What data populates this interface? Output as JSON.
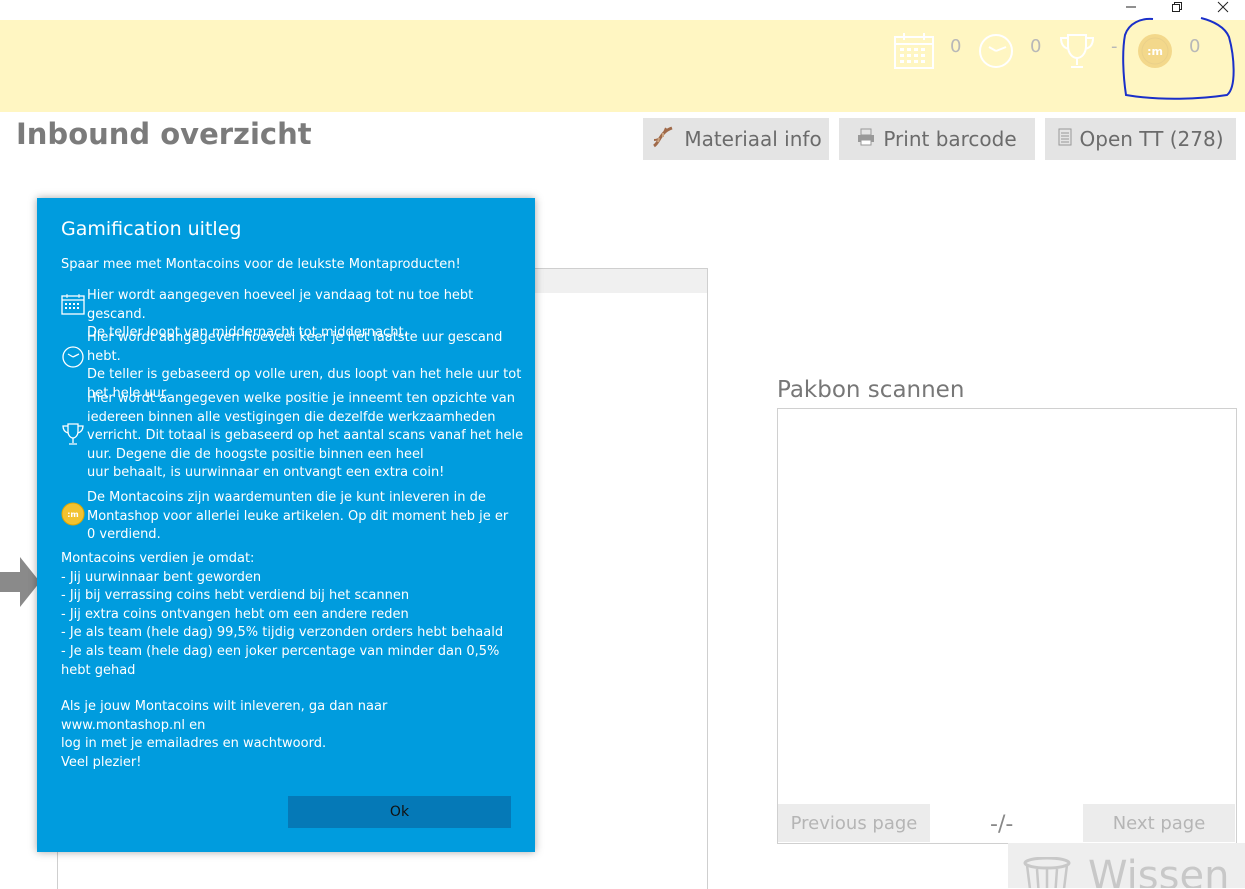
{
  "stats": {
    "today_count": "0",
    "hour_count": "0",
    "position": "-",
    "coins": "0"
  },
  "page": {
    "title": "Inbound overzicht"
  },
  "toolbar": {
    "materiaal_info": "Materiaal info",
    "print_barcode": "Print barcode",
    "open_tt": "Open TT (278)"
  },
  "pakbon": {
    "title": "Pakbon scannen",
    "previous": "Previous page",
    "next": "Next page",
    "indicator": "-/-"
  },
  "wissen": {
    "label": "Wissen"
  },
  "dialog": {
    "title": "Gamification uitleg",
    "intro": "Spaar mee met Montacoins voor de leukste Montaproducten!",
    "items": [
      {
        "icon": "calendar-icon",
        "lines": [
          "Hier wordt aangegeven hoeveel je vandaag tot nu toe hebt gescand.",
          "De teller loopt van middernacht tot middernacht."
        ]
      },
      {
        "icon": "clock-icon",
        "lines": [
          "Hier wordt aangegeven hoeveel keer je het laatste uur gescand hebt.",
          "De teller is gebaseerd op volle uren, dus loopt van het hele uur tot",
          "het hele uur."
        ]
      },
      {
        "icon": "trophy-icon",
        "lines": [
          "Hier wordt aangegeven welke positie je inneemt ten opzichte van",
          "iedereen binnen alle vestigingen die dezelfde werkzaamheden",
          "verricht. Dit totaal is gebaseerd op het aantal scans vanaf het hele",
          "uur. Degene die de hoogste positie binnen een heel",
          "uur behaalt, is uurwinnaar en ontvangt een extra coin!"
        ]
      },
      {
        "icon": "montacoin-icon",
        "lines": [
          "De Montacoins zijn waardemunten die je kunt inleveren in de",
          "Montashop voor allerlei leuke artikelen. Op dit moment heb je er",
          "0 verdiend."
        ]
      }
    ],
    "earn_lines": [
      "Montacoins verdien je omdat:",
      "- Jij uurwinnaar bent geworden",
      "- Jij bij verrassing coins hebt verdiend bij het scannen",
      "- Jij extra coins ontvangen hebt om een andere reden",
      "- Je als team (hele dag) 99,5% tijdig verzonden orders hebt behaald",
      "- Je als team (hele dag) een joker percentage van minder dan 0,5%",
      "hebt gehad"
    ],
    "redeem_lines": [
      "Als je jouw Montacoins wilt inleveren, ga dan naar www.montashop.nl en",
      "log in met je emailadres en wachtwoord."
    ],
    "closing": "Veel plezier!",
    "ok": "Ok"
  },
  "colors": {
    "stats_bar": "#fff6c2",
    "dialog": "#009cde",
    "ok_button": "#0579b7",
    "annotation": "#1a2fc9"
  }
}
